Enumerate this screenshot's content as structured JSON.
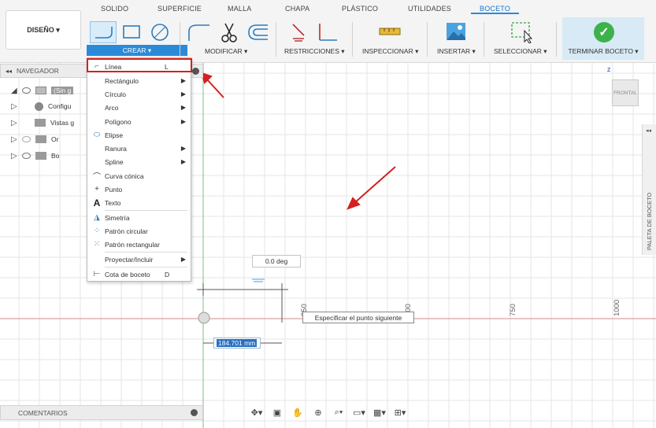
{
  "tabs": [
    "SOLIDO",
    "SUPERFICIE",
    "MALLA",
    "CHAPA",
    "PLÁSTICO",
    "UTILIDADES",
    "BOCETO"
  ],
  "active_tab": "BOCETO",
  "design_button": "DISEÑO ▾",
  "groups": {
    "crear": "CREAR ▾",
    "modificar": "MODIFICAR ▾",
    "restricciones": "RESTRICCIONES ▾",
    "inspeccionar": "INSPECCIONAR ▾",
    "insertar": "INSERTAR ▾",
    "seleccionar": "SELECCIONAR ▾",
    "terminar": "TERMINAR BOCETO ▾"
  },
  "navigator": {
    "title": "NAVEGADOR",
    "rows": [
      "(Sin g",
      "Configu",
      "Vistas g",
      "Or",
      "Bo"
    ]
  },
  "menu": {
    "items": [
      {
        "label": "Línea",
        "shortcut": "L",
        "icon": "line-icon"
      },
      {
        "label": "Rectángulo",
        "submenu": true
      },
      {
        "label": "Círculo",
        "submenu": true
      },
      {
        "label": "Arco",
        "submenu": true
      },
      {
        "label": "Polígono",
        "submenu": true
      },
      {
        "label": "Elipse",
        "icon": "ellipse-icon"
      },
      {
        "label": "Ranura",
        "submenu": true
      },
      {
        "label": "Spline",
        "submenu": true
      },
      {
        "label": "Curva cónica",
        "icon": "conic-curve-icon"
      },
      {
        "label": "Punto",
        "icon": "point-icon"
      },
      {
        "label": "Texto",
        "icon": "text-icon"
      },
      {
        "label": "Simetría",
        "icon": "mirror-icon"
      },
      {
        "label": "Patrón circular",
        "icon": "circular-pattern-icon"
      },
      {
        "label": "Patrón rectangular",
        "icon": "rectangular-pattern-icon"
      },
      {
        "label": "Proyectar/Incluir",
        "submenu": true
      },
      {
        "label": "Cota de boceto",
        "shortcut": "D",
        "icon": "sketch-dimension-icon"
      }
    ]
  },
  "canvas": {
    "angle_value": "0.0 deg",
    "tooltip": "Especificar el punto siguiente",
    "length_value": "184.701 mm",
    "axis_labels": [
      "250",
      "500",
      "750",
      "1000"
    ]
  },
  "viewcube": {
    "face": "FRONTAL",
    "axis": "Z"
  },
  "palette_label": "PALETA DE BOCETO",
  "comments_label": "COMENTARIOS",
  "colors": {
    "accent": "#2a8ad8",
    "finish_green": "#3db24a",
    "highlight_red": "#d42020",
    "axis_red": "#d98a8a",
    "axis_green": "#7cc27c"
  }
}
